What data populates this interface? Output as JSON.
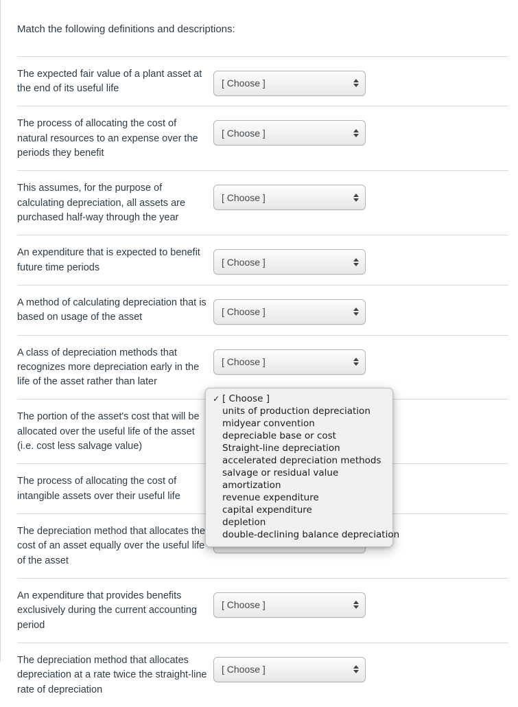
{
  "prompt": "Match the following definitions and descriptions:",
  "select_placeholder": "[ Choose ]",
  "colors": {
    "text": "#2d3b45",
    "separator": "#d7dadc",
    "select_border": "#b4b4b4",
    "focus_ring": "#cfe4f7",
    "menu_background": "#f0f0f0"
  },
  "rows": [
    {
      "text": "The expected fair value of a plant asset at the end of its useful life",
      "value": "[ Choose ]",
      "open": false
    },
    {
      "text": "The process of allocating the cost of natural resources to an expense over the periods they benefit",
      "value": "[ Choose ]",
      "open": false
    },
    {
      "text": "This assumes, for the purpose of calculating depreciation, all assets are purchased half-way through the year",
      "value": "[ Choose ]",
      "open": false
    },
    {
      "text": "An expenditure that is expected to benefit future time periods",
      "value": "[ Choose ]",
      "open": false
    },
    {
      "text": "A method of calculating depreciation that is based on usage of the asset",
      "value": "[ Choose ]",
      "open": false
    },
    {
      "text": "A class of depreciation methods that recognizes more depreciation early in the life of the asset rather than later",
      "value": "[ Choose ]",
      "open": false
    },
    {
      "text": "The portion of the asset's cost that will be allocated over the useful life of the asset (i.e. cost less salvage value)",
      "value": "[ Choose ]",
      "open": true
    },
    {
      "text": "The process of allocating the cost of intangible assets over their useful life",
      "value": "[ Choose ]",
      "open": false
    },
    {
      "text": "The depreciation method that allocates the cost of an asset equally over the useful life of the asset",
      "value": "[ Choose ]",
      "open": false
    },
    {
      "text": "An expenditure that provides benefits exclusively during the current accounting period",
      "value": "[ Choose ]",
      "open": false
    },
    {
      "text": "The depreciation method that allocates depreciation at a rate twice the straight-line rate of depreciation",
      "value": "[ Choose ]",
      "open": false
    }
  ],
  "dropdown": {
    "open_for_row_index": 6,
    "selected": "[ Choose ]",
    "checkmark": "✓",
    "options": [
      "[ Choose ]",
      "units of production depreciation",
      "midyear convention",
      "depreciable base or cost",
      "Straight-line depreciation",
      "accelerated depreciation methods",
      "salvage or residual value",
      "amortization",
      "revenue expenditure",
      "capital expenditure",
      "depletion",
      "double-declining balance depreciation"
    ]
  }
}
